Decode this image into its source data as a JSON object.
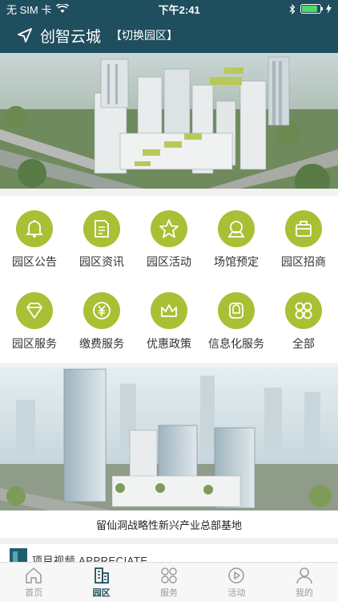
{
  "status_bar": {
    "carrier": "无 SIM 卡",
    "time": "下午2:41",
    "battery_level": 0.85
  },
  "navbar": {
    "title": "创智云城",
    "switch_label": "【切换园区】"
  },
  "grid": [
    {
      "label": "园区公告",
      "icon": "bell-icon"
    },
    {
      "label": "园区资讯",
      "icon": "document-icon"
    },
    {
      "label": "园区活动",
      "icon": "star-icon"
    },
    {
      "label": "场馆预定",
      "icon": "venue-icon"
    },
    {
      "label": "园区招商",
      "icon": "briefcase-icon"
    },
    {
      "label": "园区服务",
      "icon": "diamond-icon"
    },
    {
      "label": "缴费服务",
      "icon": "yuan-coin-icon"
    },
    {
      "label": "优惠政策",
      "icon": "crown-icon"
    },
    {
      "label": "信息化服务",
      "icon": "info-service-icon"
    },
    {
      "label": "全部",
      "icon": "grid-all-icon"
    }
  ],
  "banner2": {
    "caption": "留仙洞战略性新兴产业总部基地"
  },
  "section": {
    "title": "项目视频 APPRECIATE"
  },
  "tabbar": [
    {
      "label": "首页",
      "icon": "home-icon",
      "active": false
    },
    {
      "label": "园区",
      "icon": "park-icon",
      "active": true
    },
    {
      "label": "服务",
      "icon": "services-icon",
      "active": false
    },
    {
      "label": "活动",
      "icon": "play-icon",
      "active": false
    },
    {
      "label": "我的",
      "icon": "profile-icon",
      "active": false
    }
  ],
  "colors": {
    "header": "#1f4e5e",
    "accent": "#a8c034",
    "tab_active": "#1f4e5e",
    "tab_inactive": "#999999"
  }
}
